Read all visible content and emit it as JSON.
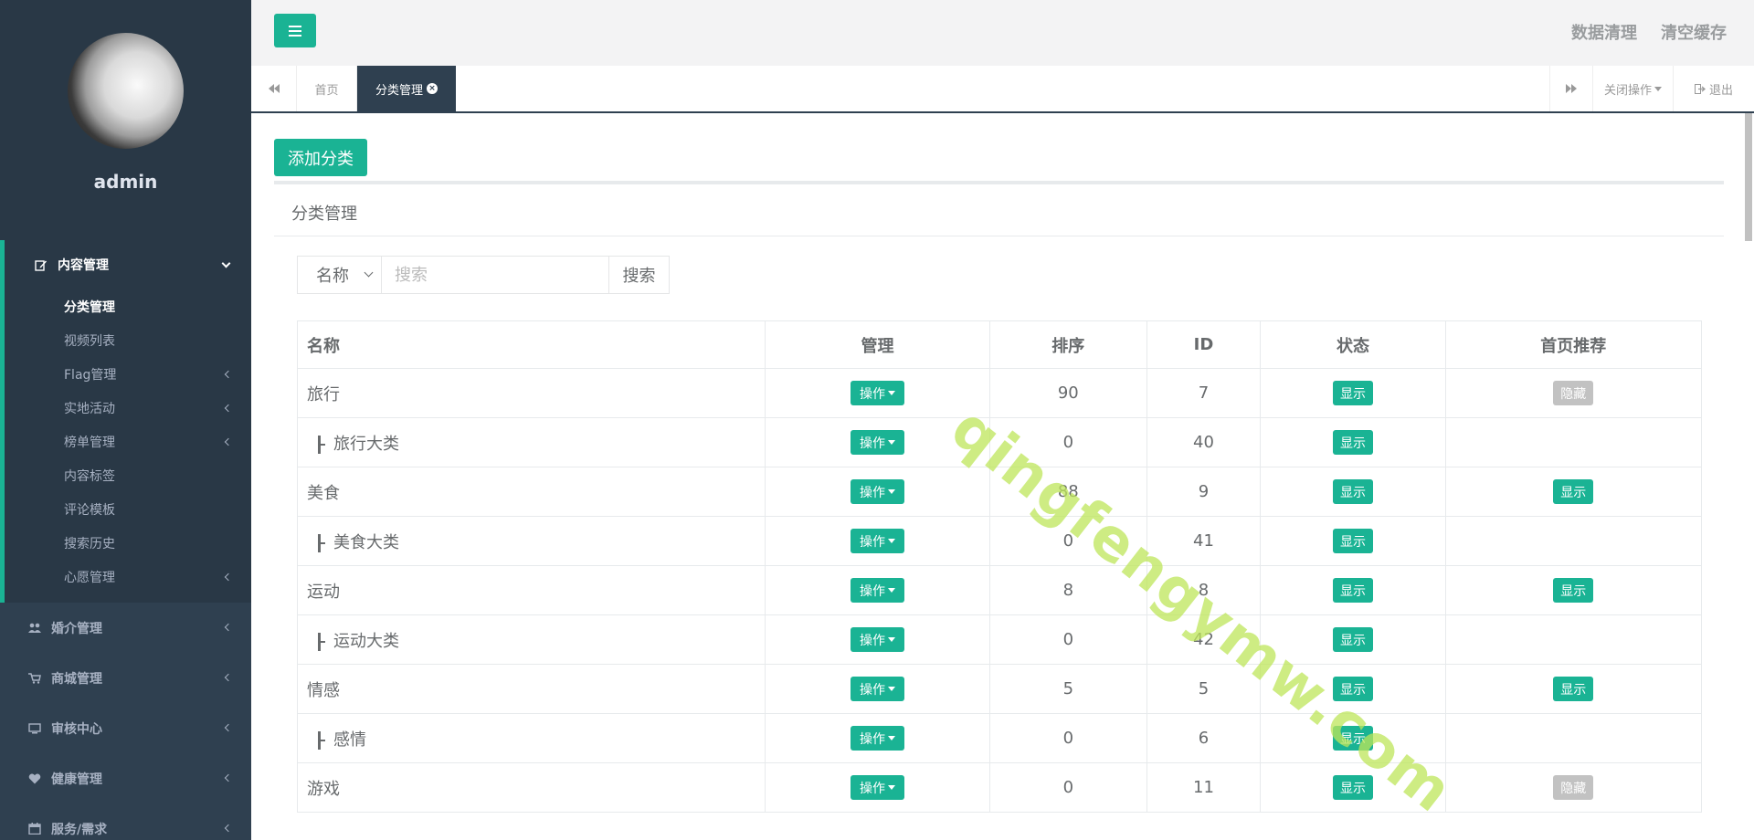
{
  "user": {
    "name": "admin"
  },
  "sidebar": {
    "group": {
      "label": "内容管理",
      "icon": "edit-icon",
      "items": [
        {
          "label": "分类管理",
          "active": true
        },
        {
          "label": "视频列表"
        },
        {
          "label": "Flag管理",
          "submenu": true
        },
        {
          "label": "实地活动",
          "submenu": true
        },
        {
          "label": "榜单管理",
          "submenu": true
        },
        {
          "label": "内容标签"
        },
        {
          "label": "评论模板"
        },
        {
          "label": "搜索历史"
        },
        {
          "label": "心愿管理",
          "submenu": true
        }
      ]
    },
    "nav": [
      {
        "label": "婚介管理",
        "icon": "users-icon"
      },
      {
        "label": "商城管理",
        "icon": "cart-icon"
      },
      {
        "label": "审核中心",
        "icon": "monitor-icon"
      },
      {
        "label": "健康管理",
        "icon": "heart-icon"
      },
      {
        "label": "服务/需求",
        "icon": "calendar-icon"
      }
    ]
  },
  "topbar": {
    "data_clean": "数据清理",
    "clear_cache": "清空缓存"
  },
  "tabs": {
    "home": "首页",
    "current": "分类管理",
    "close_ops": "关闭操作",
    "logout": "退出"
  },
  "content": {
    "add_button": "添加分类",
    "panel_title": "分类管理",
    "search": {
      "field": "名称",
      "placeholder": "搜索",
      "button": "搜索"
    },
    "table": {
      "headers": [
        "名称",
        "管理",
        "排序",
        "ID",
        "状态",
        "首页推荐"
      ],
      "op_label": "操作",
      "rows": [
        {
          "name": "旅行",
          "child": false,
          "sort": "90",
          "id": "7",
          "status": "显示",
          "home": "隐藏",
          "home_on": false
        },
        {
          "name": "旅行大类",
          "child": true,
          "sort": "0",
          "id": "40",
          "status": "显示",
          "home": "",
          "home_on": null
        },
        {
          "name": "美食",
          "child": false,
          "sort": "88",
          "id": "9",
          "status": "显示",
          "home": "显示",
          "home_on": true
        },
        {
          "name": "美食大类",
          "child": true,
          "sort": "0",
          "id": "41",
          "status": "显示",
          "home": "",
          "home_on": null
        },
        {
          "name": "运动",
          "child": false,
          "sort": "8",
          "id": "8",
          "status": "显示",
          "home": "显示",
          "home_on": true
        },
        {
          "name": "运动大类",
          "child": true,
          "sort": "0",
          "id": "42",
          "status": "显示",
          "home": "",
          "home_on": null
        },
        {
          "name": "情感",
          "child": false,
          "sort": "5",
          "id": "5",
          "status": "显示",
          "home": "显示",
          "home_on": true
        },
        {
          "name": "感情",
          "child": true,
          "sort": "0",
          "id": "6",
          "status": "显示",
          "home": "",
          "home_on": null
        },
        {
          "name": "游戏",
          "child": false,
          "sort": "0",
          "id": "11",
          "status": "显示",
          "home": "隐藏",
          "home_on": false
        }
      ]
    }
  },
  "watermark": "qingfengymw.com",
  "colors": {
    "accent": "#1ab394",
    "sidebar": "#2f4050",
    "sidebar_dark": "#293846"
  }
}
